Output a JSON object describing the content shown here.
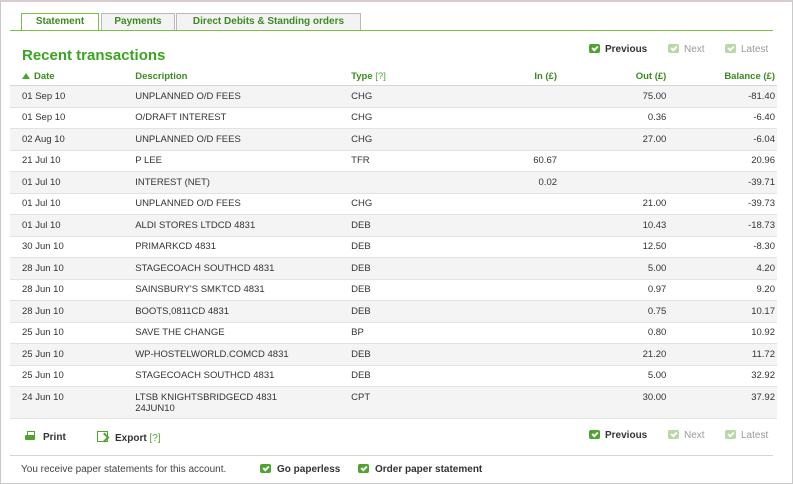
{
  "tabs": [
    {
      "label": "Statement",
      "active": true
    },
    {
      "label": "Payments",
      "active": false
    },
    {
      "label": "Direct Debits & Standing orders",
      "active": false
    }
  ],
  "title": "Recent transactions",
  "pager": {
    "previous": "Previous",
    "next": "Next",
    "latest": "Latest"
  },
  "table": {
    "headers": {
      "date": "Date",
      "description": "Description",
      "type": "Type",
      "type_help": "[?]",
      "in": "In (£)",
      "out": "Out (£)",
      "balance": "Balance (£)"
    },
    "rows": [
      {
        "date": "01 Sep 10",
        "description": "UNPLANNED O/D FEES",
        "type": "CHG",
        "in": "",
        "out": "75.00",
        "balance": "-81.40"
      },
      {
        "date": "01 Sep 10",
        "description": "O/DRAFT INTEREST",
        "type": "CHG",
        "in": "",
        "out": "0.36",
        "balance": "-6.40"
      },
      {
        "date": "02 Aug 10",
        "description": "UNPLANNED O/D FEES",
        "type": "CHG",
        "in": "",
        "out": "27.00",
        "balance": "-6.04"
      },
      {
        "date": "21 Jul 10",
        "description": "P LEE",
        "type": "TFR",
        "in": "60.67",
        "out": "",
        "balance": "20.96"
      },
      {
        "date": "01 Jul 10",
        "description": "INTEREST (NET)",
        "type": "",
        "in": "0.02",
        "out": "",
        "balance": "-39.71"
      },
      {
        "date": "01 Jul 10",
        "description": "UNPLANNED O/D FEES",
        "type": "CHG",
        "in": "",
        "out": "21.00",
        "balance": "-39.73"
      },
      {
        "date": "01 Jul 10",
        "description": "ALDI STORES LTDCD 4831",
        "type": "DEB",
        "in": "",
        "out": "10.43",
        "balance": "-18.73"
      },
      {
        "date": "30 Jun 10",
        "description": "PRIMARKCD 4831",
        "type": "DEB",
        "in": "",
        "out": "12.50",
        "balance": "-8.30"
      },
      {
        "date": "28 Jun 10",
        "description": "STAGECOACH SOUTHCD 4831",
        "type": "DEB",
        "in": "",
        "out": "5.00",
        "balance": "4.20"
      },
      {
        "date": "28 Jun 10",
        "description": "SAINSBURY'S SMKTCD 4831",
        "type": "DEB",
        "in": "",
        "out": "0.97",
        "balance": "9.20"
      },
      {
        "date": "28 Jun 10",
        "description": "BOOTS,0811CD 4831",
        "type": "DEB",
        "in": "",
        "out": "0.75",
        "balance": "10.17"
      },
      {
        "date": "25 Jun 10",
        "description": "SAVE THE CHANGE",
        "type": "BP",
        "in": "",
        "out": "0.80",
        "balance": "10.92"
      },
      {
        "date": "25 Jun 10",
        "description": "WP-HOSTELWORLD.COMCD 4831",
        "type": "DEB",
        "in": "",
        "out": "21.20",
        "balance": "11.72"
      },
      {
        "date": "25 Jun 10",
        "description": "STAGECOACH SOUTHCD 4831",
        "type": "DEB",
        "in": "",
        "out": "5.00",
        "balance": "32.92"
      },
      {
        "date": "24 Jun 10",
        "description": "LTSB KNIGHTSBRIDGECD 4831",
        "description2": "24JUN10",
        "type": "CPT",
        "in": "",
        "out": "30.00",
        "balance": "37.92"
      }
    ]
  },
  "footer": {
    "print": "Print",
    "export": "Export",
    "export_help": "[?]",
    "paper_text": "You receive paper statements for this account.",
    "go_paperless": "Go paperless",
    "order_paper": "Order paper statement"
  },
  "colors": {
    "brand_green": "#3aa420",
    "accent_green": "#4ea42d"
  }
}
